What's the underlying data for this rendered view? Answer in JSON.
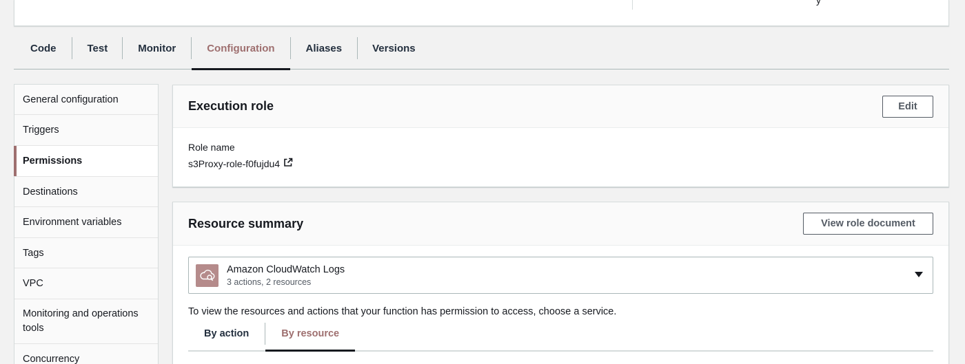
{
  "top_card": {
    "fragment": "y"
  },
  "tabs": [
    {
      "label": "Code"
    },
    {
      "label": "Test"
    },
    {
      "label": "Monitor"
    },
    {
      "label": "Configuration",
      "active": true
    },
    {
      "label": "Aliases"
    },
    {
      "label": "Versions"
    }
  ],
  "sidebar": {
    "items": [
      {
        "label": "General configuration"
      },
      {
        "label": "Triggers"
      },
      {
        "label": "Permissions",
        "active": true
      },
      {
        "label": "Destinations"
      },
      {
        "label": "Environment variables"
      },
      {
        "label": "Tags"
      },
      {
        "label": "VPC"
      },
      {
        "label": "Monitoring and operations tools"
      },
      {
        "label": "Concurrency"
      }
    ]
  },
  "execution_role": {
    "title": "Execution role",
    "edit_label": "Edit",
    "role_name_label": "Role name",
    "role_name_value": "s3Proxy-role-f0fujdu4",
    "external_link_icon": "external-link-icon"
  },
  "resource_summary": {
    "title": "Resource summary",
    "view_doc_label": "View role document",
    "service": {
      "icon": "cloudwatch-logs-icon",
      "name": "Amazon CloudWatch Logs",
      "detail": "3 actions, 2 resources"
    },
    "help_text": "To view the resources and actions that your function has permission to access, choose a service.",
    "subtabs": [
      {
        "label": "By action"
      },
      {
        "label": "By resource",
        "active": true
      }
    ]
  },
  "colors": {
    "accent": "#9e6f6f",
    "service_icon_bg": "#b58b8b",
    "page_bg": "#f2f2f2"
  }
}
